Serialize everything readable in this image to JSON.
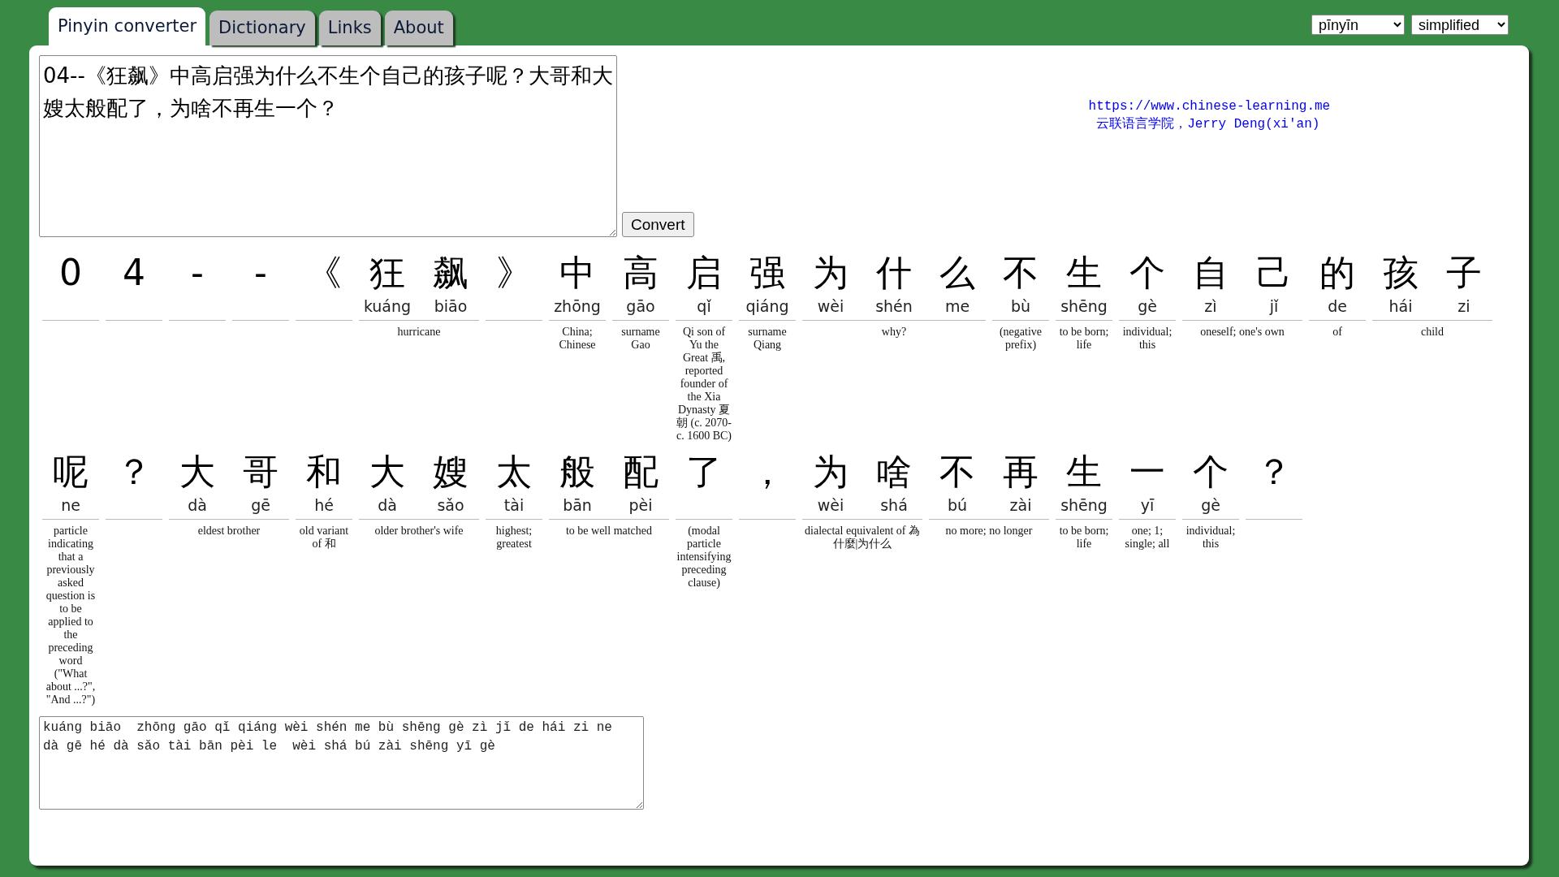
{
  "tabs": [
    {
      "label": "Pinyin converter",
      "selected": true
    },
    {
      "label": "Dictionary",
      "selected": false
    },
    {
      "label": "Links",
      "selected": false
    },
    {
      "label": "About",
      "selected": false
    }
  ],
  "selects": [
    {
      "value": "pīnyīn"
    },
    {
      "value": "simplified"
    }
  ],
  "input": {
    "value": "04--《狂飙》中高启强为什么不生个自己的孩子呢？大哥和大嫂太般配了，为啥不再生一个？"
  },
  "convert_button": "Convert",
  "credits": {
    "link": "https://www.chinese-learning.me",
    "author": "云联语言学院，Jerry Deng(xi'an)"
  },
  "words": [
    {
      "chars": [
        {
          "hanzi": "0"
        }
      ]
    },
    {
      "chars": [
        {
          "hanzi": "4"
        }
      ]
    },
    {
      "chars": [
        {
          "hanzi": "-"
        }
      ]
    },
    {
      "chars": [
        {
          "hanzi": "-"
        }
      ]
    },
    {
      "chars": [
        {
          "hanzi": "《"
        }
      ]
    },
    {
      "chars": [
        {
          "hanzi": "狂",
          "pinyin": "kuáng"
        },
        {
          "hanzi": "飙",
          "pinyin": "biāo"
        }
      ],
      "definition": "hurricane"
    },
    {
      "chars": [
        {
          "hanzi": "》"
        }
      ]
    },
    {
      "chars": [
        {
          "hanzi": "中",
          "pinyin": "zhōng"
        }
      ],
      "definition": "China; Chinese"
    },
    {
      "chars": [
        {
          "hanzi": "高",
          "pinyin": "gāo"
        }
      ],
      "definition": "surname Gao"
    },
    {
      "chars": [
        {
          "hanzi": "启",
          "pinyin": "qǐ"
        }
      ],
      "definition": "Qi son of Yu the Great 禹, reported founder of the Xia Dynasty 夏朝 (c. 2070-c. 1600 BC)"
    },
    {
      "chars": [
        {
          "hanzi": "强",
          "pinyin": "qiáng"
        }
      ],
      "definition": "surname Qiang"
    },
    {
      "chars": [
        {
          "hanzi": "为",
          "pinyin": "wèi"
        },
        {
          "hanzi": "什",
          "pinyin": "shén"
        },
        {
          "hanzi": "么",
          "pinyin": "me"
        }
      ],
      "definition": "why?"
    },
    {
      "chars": [
        {
          "hanzi": "不",
          "pinyin": "bù"
        }
      ],
      "definition": "(negative prefix)"
    },
    {
      "chars": [
        {
          "hanzi": "生",
          "pinyin": "shēng"
        }
      ],
      "definition": "to be born; life"
    },
    {
      "chars": [
        {
          "hanzi": "个",
          "pinyin": "gè"
        }
      ],
      "definition": "individual; this"
    },
    {
      "chars": [
        {
          "hanzi": "自",
          "pinyin": "zì"
        },
        {
          "hanzi": "己",
          "pinyin": "jǐ"
        }
      ],
      "definition": "oneself; one's own"
    },
    {
      "chars": [
        {
          "hanzi": "的",
          "pinyin": "de"
        }
      ],
      "definition": "of"
    },
    {
      "chars": [
        {
          "hanzi": "孩",
          "pinyin": "hái"
        },
        {
          "hanzi": "子",
          "pinyin": "zi"
        }
      ],
      "definition": "child"
    },
    {
      "chars": [
        {
          "hanzi": "呢",
          "pinyin": "ne"
        }
      ],
      "definition": "particle indicating that a previously asked question is to be applied to the preceding word (\"What about ...?\", \"And ...?\")"
    },
    {
      "chars": [
        {
          "hanzi": "？"
        }
      ]
    },
    {
      "chars": [
        {
          "hanzi": "大",
          "pinyin": "dà"
        },
        {
          "hanzi": "哥",
          "pinyin": "gē"
        }
      ],
      "definition": "eldest brother"
    },
    {
      "chars": [
        {
          "hanzi": "和",
          "pinyin": "hé"
        }
      ],
      "definition": "old variant of 和"
    },
    {
      "chars": [
        {
          "hanzi": "大",
          "pinyin": "dà"
        },
        {
          "hanzi": "嫂",
          "pinyin": "sǎo"
        }
      ],
      "definition": "older brother's wife"
    },
    {
      "chars": [
        {
          "hanzi": "太",
          "pinyin": "tài"
        }
      ],
      "definition": "highest; greatest"
    },
    {
      "chars": [
        {
          "hanzi": "般",
          "pinyin": "bān"
        },
        {
          "hanzi": "配",
          "pinyin": "pèi"
        }
      ],
      "definition": "to be well matched"
    },
    {
      "chars": [
        {
          "hanzi": "了"
        }
      ],
      "definition": "(modal particle intensifying preceding clause)"
    },
    {
      "chars": [
        {
          "hanzi": "，"
        }
      ]
    },
    {
      "chars": [
        {
          "hanzi": "为",
          "pinyin": "wèi"
        },
        {
          "hanzi": "啥",
          "pinyin": "shá"
        }
      ],
      "definition": "dialectal equivalent of 為什麼|为什么"
    },
    {
      "chars": [
        {
          "hanzi": "不",
          "pinyin": "bú"
        },
        {
          "hanzi": "再",
          "pinyin": "zài"
        }
      ],
      "definition": "no more; no longer"
    },
    {
      "chars": [
        {
          "hanzi": "生",
          "pinyin": "shēng"
        }
      ],
      "definition": "to be born; life"
    },
    {
      "chars": [
        {
          "hanzi": "一",
          "pinyin": "yī"
        }
      ],
      "definition": "one; 1; single; all"
    },
    {
      "chars": [
        {
          "hanzi": "个",
          "pinyin": "gè"
        }
      ],
      "definition": "individual; this"
    },
    {
      "chars": [
        {
          "hanzi": "？"
        }
      ]
    }
  ],
  "output": {
    "value": "kuáng biāo  zhōng gāo qǐ qiáng wèi shén me bù shēng gè zì jǐ de hái zi ne  dà gē hé dà sǎo tài bān pèi le  wèi shá bú zài shēng yī gè"
  }
}
